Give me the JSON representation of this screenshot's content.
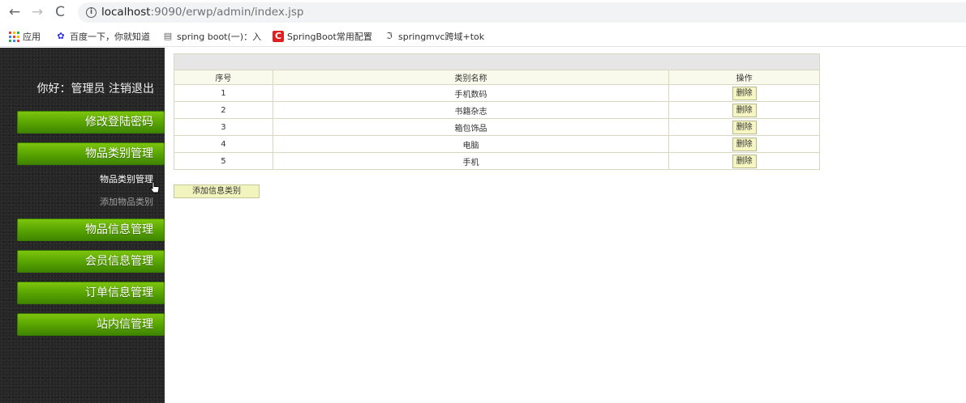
{
  "browser": {
    "url_host": "localhost",
    "url_rest": ":9090/erwp/admin/index.jsp",
    "bookmarks": [
      {
        "label": "应用",
        "icon": "apps-grid-icon"
      },
      {
        "label": "百度一下，你就知道",
        "icon": "baidu-paw-icon"
      },
      {
        "label": "spring boot(一)：入",
        "icon": "page-icon"
      },
      {
        "label": "SpringBoot常用配置",
        "icon": "csdn-c-icon"
      },
      {
        "label": "springmvc跨域+tok",
        "icon": "feather-icon"
      }
    ]
  },
  "sidebar": {
    "greeting": "你好：管理员",
    "logout": "注销退出",
    "menu": {
      "change_password": "修改登陆密码",
      "category_mgmt": "物品类别管理",
      "item_info_mgmt": "物品信息管理",
      "member_info_mgmt": "会员信息管理",
      "order_info_mgmt": "订单信息管理",
      "site_message_mgmt": "站内信管理"
    },
    "submenu": {
      "category_list": "物品类别管理",
      "add_category": "添加物品类别"
    }
  },
  "table": {
    "headers": [
      "序号",
      "类别名称",
      "操作"
    ],
    "rows": [
      {
        "id": "1",
        "name": "手机数码",
        "action": "删除"
      },
      {
        "id": "2",
        "name": "书籍杂志",
        "action": "删除"
      },
      {
        "id": "3",
        "name": "箱包饰品",
        "action": "删除"
      },
      {
        "id": "4",
        "name": "电脑",
        "action": "删除"
      },
      {
        "id": "5",
        "name": "手机",
        "action": "删除"
      }
    ]
  },
  "add_button": "添加信息类别",
  "colors": {
    "menu_green": "#56a200",
    "sidebar_bg": "#262626",
    "header_bg": "#fafaec",
    "button_bg": "#f6f6c2"
  }
}
